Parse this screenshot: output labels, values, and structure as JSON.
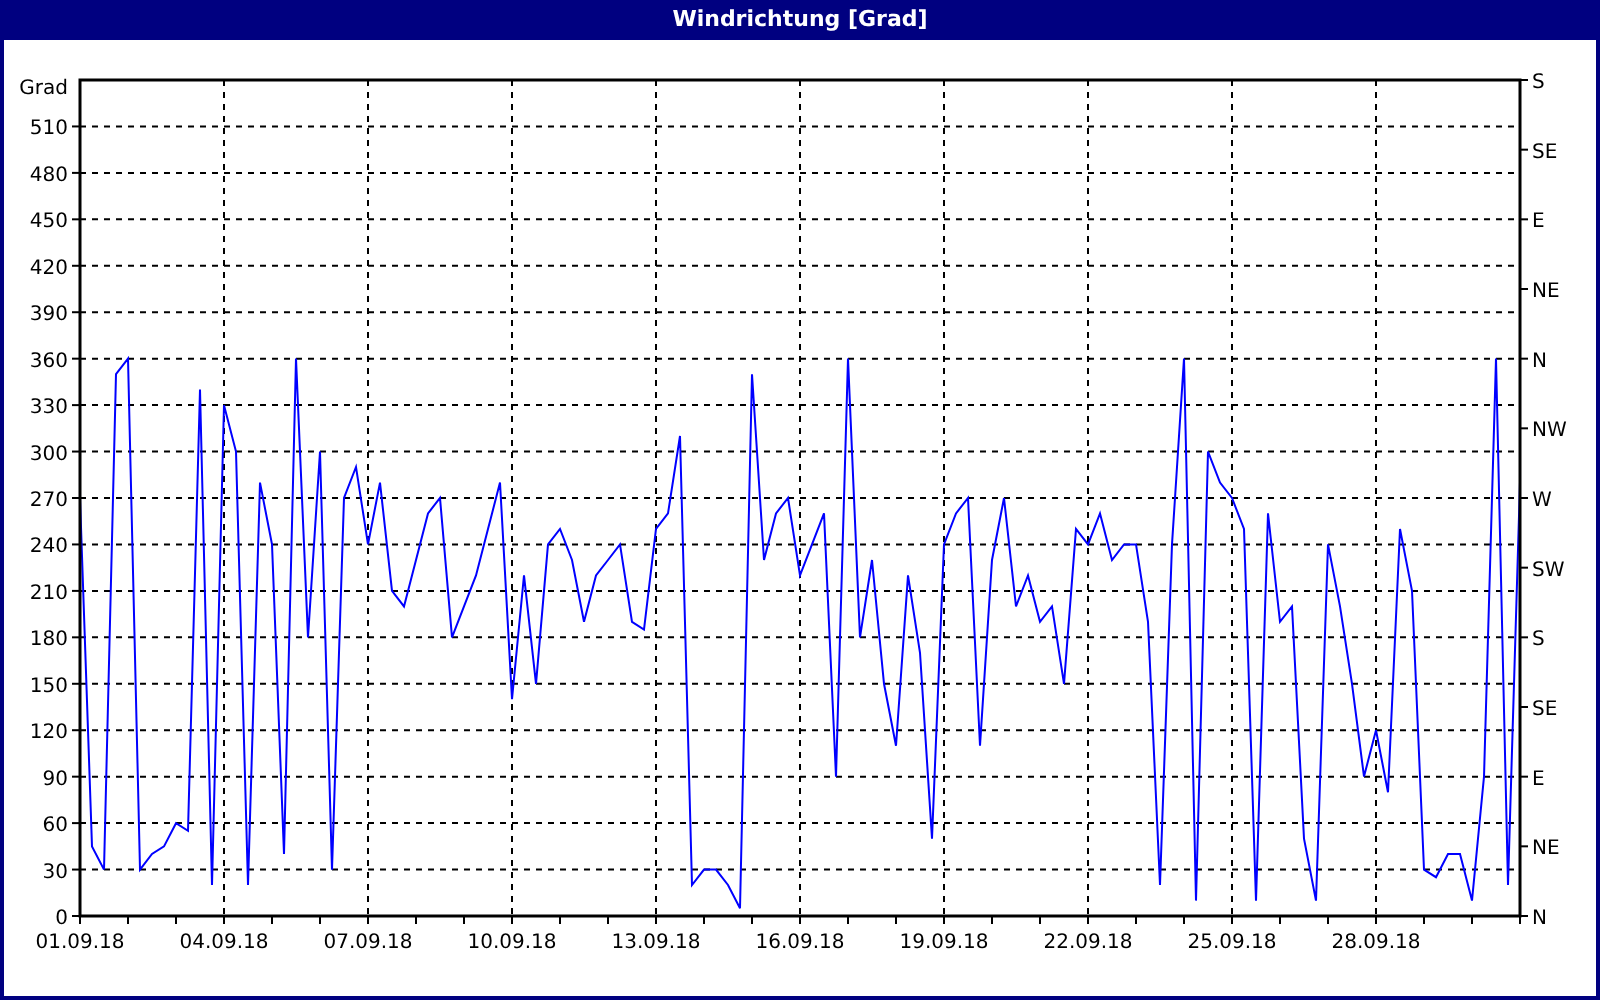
{
  "window": {
    "title": "Windrichtung [Grad]"
  },
  "chart": {
    "right_axis_labels": [
      "S",
      "SE",
      "E",
      "NE",
      "N",
      "NW",
      "W",
      "SW",
      "S",
      "SE",
      "E",
      "NE",
      "N"
    ],
    "chart_data": {
      "type": "line",
      "grid": true,
      "ylabel": "Grad",
      "ylim": [
        0,
        540
      ],
      "yticks": [
        0,
        30,
        60,
        90,
        120,
        150,
        180,
        210,
        240,
        270,
        300,
        330,
        360,
        390,
        420,
        450,
        480,
        510
      ],
      "categories": [
        "01.09.18",
        null,
        null,
        null,
        null,
        null,
        null,
        null,
        null,
        null,
        null,
        null,
        "04.09.18",
        null,
        null,
        null,
        null,
        null,
        null,
        null,
        null,
        null,
        null,
        null,
        "07.09.18",
        null,
        null,
        null,
        null,
        null,
        null,
        null,
        null,
        null,
        null,
        null,
        "10.09.18",
        null,
        null,
        null,
        null,
        null,
        null,
        null,
        null,
        null,
        null,
        null,
        "13.09.18",
        null,
        null,
        null,
        null,
        null,
        null,
        null,
        null,
        null,
        null,
        null,
        "16.09.18",
        null,
        null,
        null,
        null,
        null,
        null,
        null,
        null,
        null,
        null,
        null,
        "19.09.18",
        null,
        null,
        null,
        null,
        null,
        null,
        null,
        null,
        null,
        null,
        null,
        "22.09.18",
        null,
        null,
        null,
        null,
        null,
        null,
        null,
        null,
        null,
        null,
        null,
        "25.09.18",
        null,
        null,
        null,
        null,
        null,
        null,
        null,
        null,
        null,
        null,
        null,
        "28.09.18",
        null,
        null,
        null,
        null,
        null,
        null,
        null,
        null,
        null,
        null,
        null,
        null
      ],
      "series": [
        {
          "color": "#0000ff",
          "values": [
            270,
            45,
            30,
            350,
            360,
            30,
            40,
            45,
            60,
            55,
            340,
            20,
            330,
            300,
            20,
            280,
            240,
            40,
            360,
            180,
            300,
            30,
            270,
            290,
            240,
            280,
            210,
            200,
            230,
            260,
            270,
            180,
            200,
            220,
            250,
            280,
            140,
            220,
            150,
            240,
            250,
            230,
            190,
            220,
            230,
            240,
            190,
            185,
            250,
            260,
            310,
            20,
            30,
            30,
            20,
            5,
            350,
            230,
            260,
            270,
            220,
            240,
            260,
            90,
            360,
            180,
            230,
            150,
            110,
            220,
            170,
            50,
            240,
            260,
            270,
            110,
            230,
            270,
            200,
            220,
            190,
            200,
            150,
            250,
            240,
            260,
            230,
            240,
            240,
            190,
            20,
            240,
            360,
            10,
            300,
            280,
            270,
            250,
            10,
            260,
            190,
            200,
            50,
            10,
            240,
            200,
            150,
            90,
            120,
            80,
            250,
            210,
            30,
            25,
            40,
            40,
            10,
            90,
            360,
            20,
            280
          ]
        }
      ]
    }
  }
}
